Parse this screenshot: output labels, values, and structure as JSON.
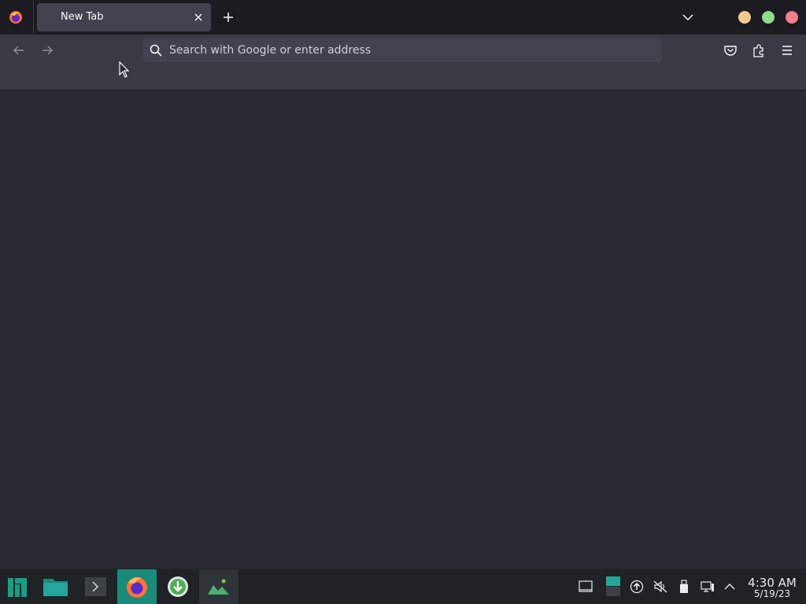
{
  "browser": {
    "tab": {
      "title": "New Tab"
    },
    "urlbar": {
      "placeholder": "Search with Google or enter address"
    },
    "window_controls": {
      "minimize_color": "#f4c98f",
      "maximize_color": "#8fdc8a",
      "close_color": "#f07f8e"
    },
    "theme": {
      "accent": "#42414d",
      "background": "#2b2a33",
      "tabstrip": "#1c1b22"
    }
  },
  "taskbar": {
    "apps": [
      {
        "name": "manjaro-menu-icon"
      },
      {
        "name": "file-manager-icon"
      },
      {
        "name": "terminal-icon"
      },
      {
        "name": "firefox-icon"
      },
      {
        "name": "download-manager-icon"
      },
      {
        "name": "image-viewer-icon"
      }
    ],
    "clock": {
      "time": "4:30 AM",
      "date": "5/19/23"
    },
    "accent": "#1a8a7a"
  }
}
